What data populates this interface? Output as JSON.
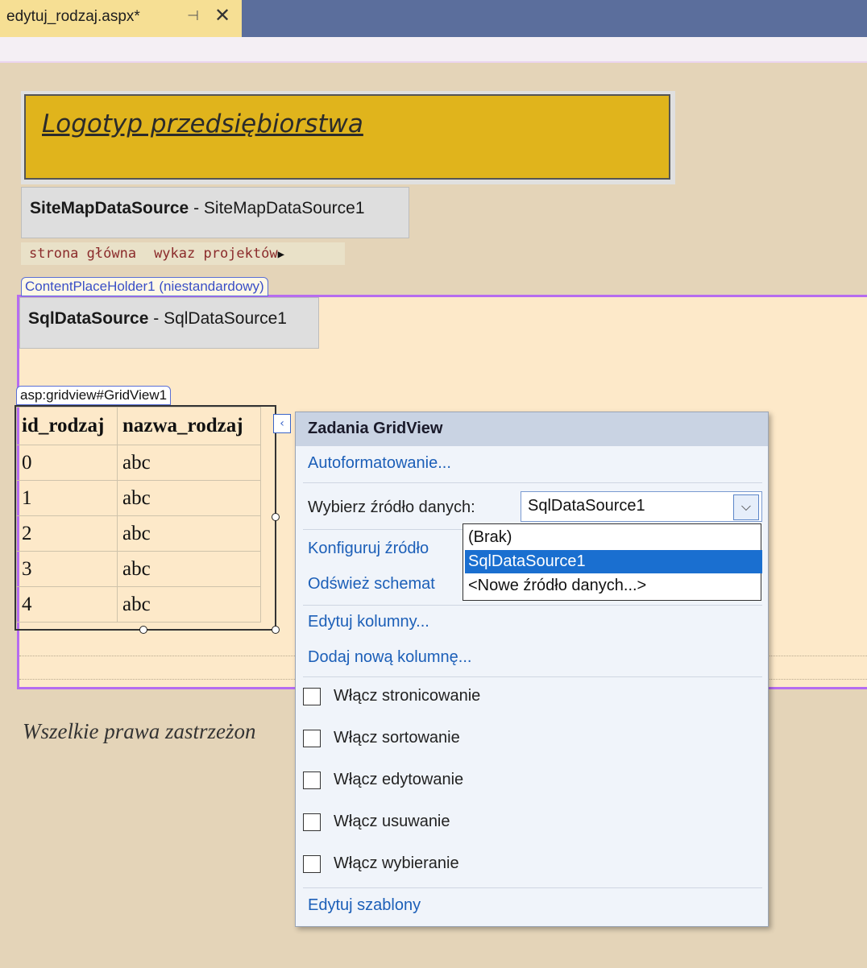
{
  "tab": {
    "title": "edytuj_rodzaj.aspx*",
    "pin": "⊣",
    "close": "✕"
  },
  "master": {
    "logo": "Logotyp przedsiębiorstwa",
    "sitemap": {
      "type": "SiteMapDataSource",
      "sep": " - ",
      "id": "SiteMapDataSource1"
    },
    "breadcrumb": [
      "strona główna",
      "wykaz projektów"
    ],
    "footer": "Wszelkie prawa zastrzeżon"
  },
  "content": {
    "placeholder_label": "ContentPlaceHolder1 (niestandardowy)",
    "sql": {
      "type": "SqlDataSource",
      "sep": " - ",
      "id": "SqlDataSource1"
    },
    "gridview_label": "asp:gridview#GridView1",
    "grid": {
      "columns": [
        "id_rodzaj",
        "nazwa_rodzaj"
      ],
      "rows": [
        [
          "0",
          "abc"
        ],
        [
          "1",
          "abc"
        ],
        [
          "2",
          "abc"
        ],
        [
          "3",
          "abc"
        ],
        [
          "4",
          "abc"
        ]
      ]
    }
  },
  "tasks": {
    "title": "Zadania GridView",
    "autoformat": "Autoformatowanie...",
    "choose_source_label": "Wybierz źródło danych:",
    "choose_source_value": "SqlDataSource1",
    "configure": "Konfiguruj źródło",
    "refresh": "Odśwież schemat",
    "source_options": [
      "(Brak)",
      "SqlDataSource1",
      "<Nowe źródło danych...>"
    ],
    "selected_option": "SqlDataSource1",
    "edit_columns": "Edytuj kolumny...",
    "add_column": "Dodaj nową kolumnę...",
    "checkboxes": [
      "Włącz stronicowanie",
      "Włącz sortowanie",
      "Włącz edytowanie",
      "Włącz usuwanie",
      "Włącz wybieranie"
    ],
    "edit_templates": "Edytuj szablony"
  },
  "colors": {
    "tabbar": "#5b6e9c",
    "logo": "#e0b41c",
    "placeholder_border": "#b66cf0",
    "link": "#1c5fb8",
    "selection": "#1a6fd0"
  }
}
